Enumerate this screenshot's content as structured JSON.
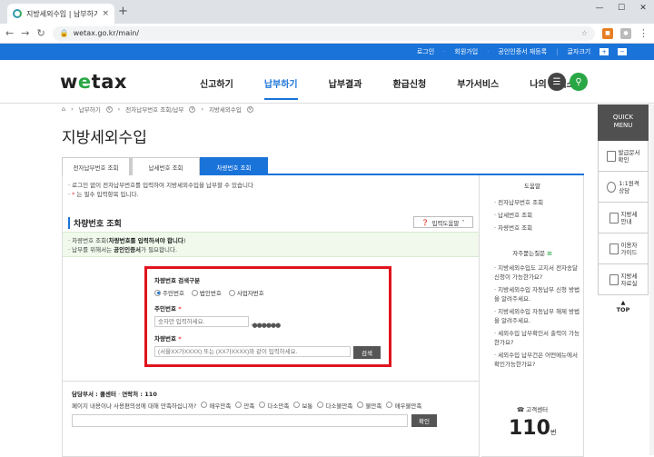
{
  "browser": {
    "tab_title": "지방세외수입 | 납부하기 > 전자",
    "tab_close": "×",
    "new_tab": "+",
    "url": "wetax.go.kr/main/",
    "win_min": "—",
    "win_max": "☐",
    "win_close": "✕"
  },
  "topbar": {
    "login": "로그인",
    "signup": "회원가입",
    "cert": "공인인증서 재등록",
    "font_size": "글자크기"
  },
  "header": {
    "logo_pre": "w",
    "logo_e": "e",
    "logo_post": "tax",
    "menu": [
      "신고하기",
      "납부하기",
      "납부결과",
      "환급신청",
      "부가서비스",
      "나의 위택스"
    ]
  },
  "breadcrumb": [
    "납부하기",
    "전자납부번호 조회/납부",
    "지방세외수입"
  ],
  "page_title": "지방세외수입",
  "tabs": [
    "전자납부번호 조회",
    "납세번호 조회",
    "차량번호 조회"
  ],
  "notes": {
    "n1": "· 로그인 없이 전자납부번호를 입력하여 지방세외수입을 납부할 수 있습니다",
    "n2_star": "*",
    "n2": " 는 필수 입력항목 입니다."
  },
  "section_title": "차량번호 조회",
  "help_button": "입력도움말",
  "info": {
    "l1_pre": "· 차량번호 조회(",
    "l1_bold": "차량번호를 입력하셔야 합니다",
    "l1_post": ")",
    "l2_pre": "· 납부를 위해서는 ",
    "l2_bold": "공인인증서",
    "l2_post": "가 필요합니다."
  },
  "form": {
    "search_type_label": "차량번호 검색구분",
    "radios": [
      "주민번호",
      "법인번호",
      "사업자번호"
    ],
    "id_label": "주민번호",
    "id_placeholder": "숫자만 입력하세요.",
    "id_mask": "-●●●●●●",
    "plate_label": "차량번호",
    "plate_placeholder": "(서울XX가XXXX) 또는 (XX가XXXX)와 같이 입력하세요.",
    "search_button": "검색"
  },
  "survey": {
    "dept": "담당부서 : 콜센터",
    "contact": "연락처 : 110",
    "question": "페이지 내용이나 사용편의성에 대해 만족하십니까?",
    "options": [
      "매우만족",
      "만족",
      "다소만족",
      "보통",
      "다소불만족",
      "불만족",
      "매우불만족"
    ],
    "confirm": "확인"
  },
  "right": {
    "help_title": "도움말",
    "help_items": [
      "전자납부번호 조회",
      "납세번호 조회",
      "차량번호 조회"
    ],
    "faq_title": "자주묻는질문",
    "faq_items": [
      "지방세외수입도 고지서 전자송달 신청이 가능한가요?",
      "지방세외수입 자동납부 신청 방법을 알려주세요.",
      "지방세외수입 자동납부 해제 방법을 알려주세요.",
      "세외수입 납부확인서 출력이 가능한가요?",
      "세외수입 납부건은 어떤메뉴에서 확인가능한가요?"
    ],
    "cs_title": "고객센터",
    "cs_number": "110",
    "cs_unit": "번"
  },
  "quick": {
    "title1": "QUICK",
    "title2": "MENU",
    "items": [
      [
        "발급문서",
        "확인"
      ],
      [
        "1:1원격",
        "상담"
      ],
      [
        "지방세",
        "안내"
      ],
      [
        "이용자",
        "가이드"
      ],
      [
        "지방세",
        "자료실"
      ]
    ],
    "top": "TOP"
  },
  "colors": {
    "brand_blue": "#1a73d9",
    "brand_green": "#2aa745",
    "highlight_red": "#e0141e"
  }
}
